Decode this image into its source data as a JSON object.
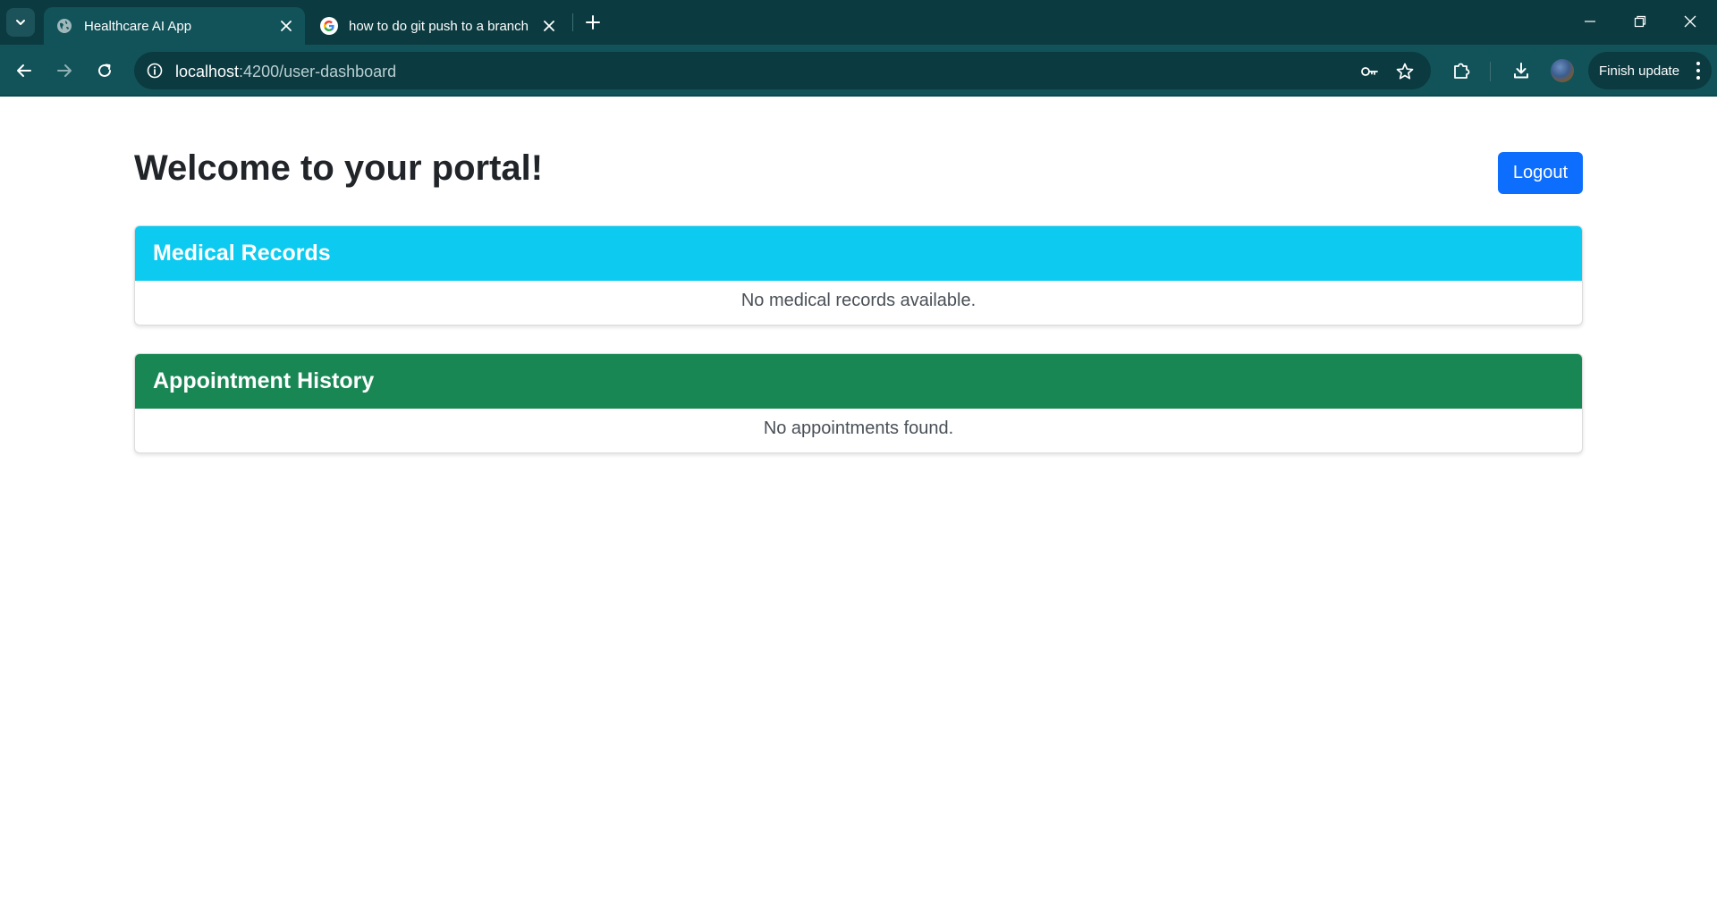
{
  "browser": {
    "tabs": [
      {
        "title": "Healthcare AI App",
        "active": true,
        "icon": "globe-icon"
      },
      {
        "title": "how to do git push to a branch",
        "active": false,
        "icon": "google-icon"
      }
    ],
    "url_host": "localhost",
    "url_path": ":4200/user-dashboard",
    "finish_update_label": "Finish update",
    "colors": {
      "tabbar": "#0b3b40",
      "toolbar": "#115359",
      "omnibox": "#0b3a40"
    }
  },
  "page": {
    "heading": "Welcome to your portal!",
    "logout_label": "Logout",
    "sections": [
      {
        "title": "Medical Records",
        "empty_text": "No medical records available.",
        "color": "#0dcaf0"
      },
      {
        "title": "Appointment History",
        "empty_text": "No appointments found.",
        "color": "#198754"
      }
    ],
    "colors": {
      "primary": "#0d6efd",
      "text": "#212529"
    }
  }
}
